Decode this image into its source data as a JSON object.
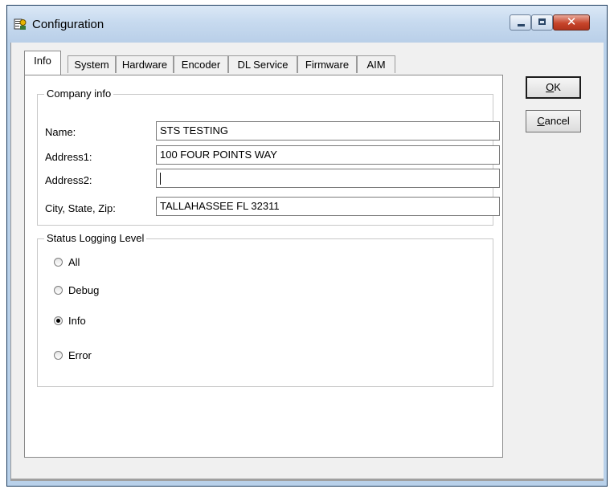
{
  "window": {
    "title": "Configuration"
  },
  "controls": {
    "minimize": "minimize",
    "maximize": "maximize",
    "close": "✕"
  },
  "tabs": [
    {
      "label": "Info",
      "active": true
    },
    {
      "label": "System",
      "active": false
    },
    {
      "label": "Hardware",
      "active": false
    },
    {
      "label": "Encoder",
      "active": false
    },
    {
      "label": "DL Service",
      "active": false
    },
    {
      "label": "Firmware",
      "active": false
    },
    {
      "label": "AIM",
      "active": false
    }
  ],
  "company_info": {
    "title": "Company info",
    "name_label": "Name:",
    "name_value": "STS TESTING",
    "address1_label": "Address1:",
    "address1_value": "100 FOUR POINTS WAY",
    "address2_label": "Address2:",
    "address2_value": "",
    "city_label": "City, State, Zip:",
    "city_value": "TALLAHASSEE FL 32311"
  },
  "status_logging": {
    "title": "Status Logging Level",
    "options": [
      {
        "label": "All",
        "selected": false
      },
      {
        "label": "Debug",
        "selected": false
      },
      {
        "label": "Info",
        "selected": true
      },
      {
        "label": "Error",
        "selected": false
      }
    ]
  },
  "buttons": {
    "ok_mnemonic": "O",
    "ok_rest": "K",
    "cancel_mnemonic": "C",
    "cancel_rest": "ancel"
  },
  "colors": {
    "titlebar": "#c7daef",
    "close_button": "#c7452b",
    "dialog_face": "#f0f0f0"
  }
}
